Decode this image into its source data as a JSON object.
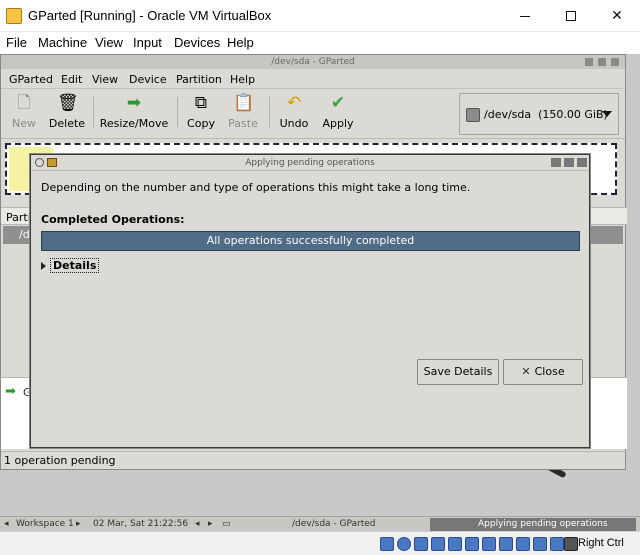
{
  "host": {
    "title": "GParted [Running] - Oracle VM VirtualBox",
    "menu": [
      "File",
      "Machine",
      "View",
      "Input",
      "Devices",
      "Help"
    ],
    "status_right": "Right Ctrl"
  },
  "gparted": {
    "window_title": "/dev/sda - GParted",
    "menu": [
      "GParted",
      "Edit",
      "View",
      "Device",
      "Partition",
      "Help"
    ],
    "toolbar": {
      "new": "New",
      "delete": "Delete",
      "resize": "Resize/Move",
      "copy": "Copy",
      "paste": "Paste",
      "undo": "Undo",
      "apply": "Apply"
    },
    "device_selector": {
      "label": "/dev/sda",
      "size": "(150.00 GiB)"
    },
    "partition_header": "Partit",
    "partition_row": "/de",
    "pending_item": "G",
    "statusbar": "1 operation pending"
  },
  "dialog": {
    "title": "Applying pending operations",
    "description": "Depending on the number and type of operations this might take a long time.",
    "completed_label": "Completed Operations:",
    "progress_text": "All operations successfully completed",
    "progress_fraction": 1.0,
    "details_label": "Details",
    "save_button": "Save Details",
    "close_button": "Close"
  },
  "guest_taskbar": {
    "workspace": "Workspace 1",
    "datetime": "02 Mar, Sat 21:22:56",
    "task1": "/dev/sda - GParted",
    "task2": "Applying pending operations"
  },
  "colors": {
    "progress": "#4f6b86",
    "gnome_bg": "#dcdad5"
  }
}
